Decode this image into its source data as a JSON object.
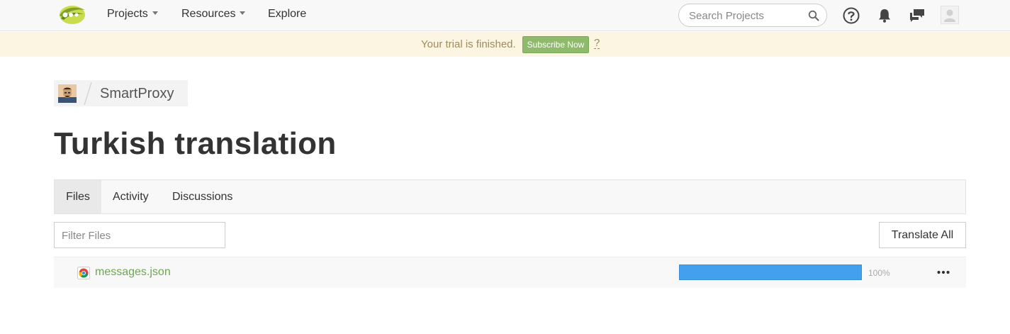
{
  "nav": {
    "items": [
      {
        "label": "Projects",
        "has_caret": true
      },
      {
        "label": "Resources",
        "has_caret": true
      },
      {
        "label": "Explore",
        "has_caret": false
      }
    ],
    "search_placeholder": "Search Projects",
    "icons": [
      "help-circle-icon",
      "bell-icon",
      "chat-bubbles-icon",
      "user-avatar-icon"
    ]
  },
  "banner": {
    "text": "Your trial is finished.",
    "button_label": "Subscribe Now",
    "help": "?"
  },
  "breadcrumb": {
    "project": "SmartProxy"
  },
  "page": {
    "title": "Turkish translation"
  },
  "tabs": [
    {
      "label": "Files",
      "active": true
    },
    {
      "label": "Activity",
      "active": false
    },
    {
      "label": "Discussions",
      "active": false
    }
  ],
  "filter_placeholder": "Filter Files",
  "translate_all_label": "Translate All",
  "files": [
    {
      "name": "messages.json",
      "progress": 100,
      "progress_label": "100%"
    }
  ],
  "colors": {
    "brand_green": "#8fb96b",
    "link_green": "#6aa84f",
    "progress_blue": "#42a0ec",
    "banner_bg": "#fcf5e2"
  }
}
